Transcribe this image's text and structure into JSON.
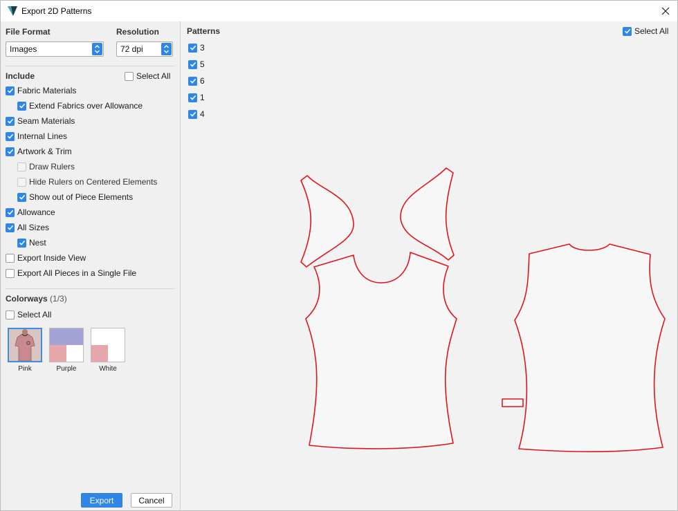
{
  "window": {
    "title": "Export 2D Patterns"
  },
  "file_format": {
    "label": "File Format",
    "value": "Images"
  },
  "resolution": {
    "label": "Resolution",
    "value": "72 dpi"
  },
  "include": {
    "label": "Include",
    "select_all": "Select All",
    "options": {
      "fabric_materials": "Fabric Materials",
      "extend_fabrics": "Extend Fabrics over Allowance",
      "seam_materials": "Seam Materials",
      "internal_lines": "Internal Lines",
      "artwork_trim": "Artwork & Trim",
      "draw_rulers": "Draw Rulers",
      "hide_rulers": "Hide Rulers on Centered Elements",
      "show_out_of_piece": "Show out of Piece Elements",
      "allowance": "Allowance",
      "all_sizes": "All Sizes",
      "nest": "Nest",
      "export_inside_view": "Export Inside View",
      "export_single_file": "Export All Pieces in a Single File"
    }
  },
  "colorways": {
    "label": "Colorways",
    "count": "(1/3)",
    "select_all": "Select All",
    "items": [
      {
        "name": "Pink"
      },
      {
        "name": "Purple"
      },
      {
        "name": "White"
      }
    ]
  },
  "patterns": {
    "label": "Patterns",
    "select_all": "Select All",
    "items": [
      "3",
      "5",
      "6",
      "1",
      "4"
    ]
  },
  "buttons": {
    "export": "Export",
    "cancel": "Cancel"
  },
  "colors": {
    "accent": "#2f86e6",
    "pattern_outline": "#e0141e",
    "purple_swatch": "#a3a3d6",
    "pink_swatch": "#e5a7a9"
  }
}
